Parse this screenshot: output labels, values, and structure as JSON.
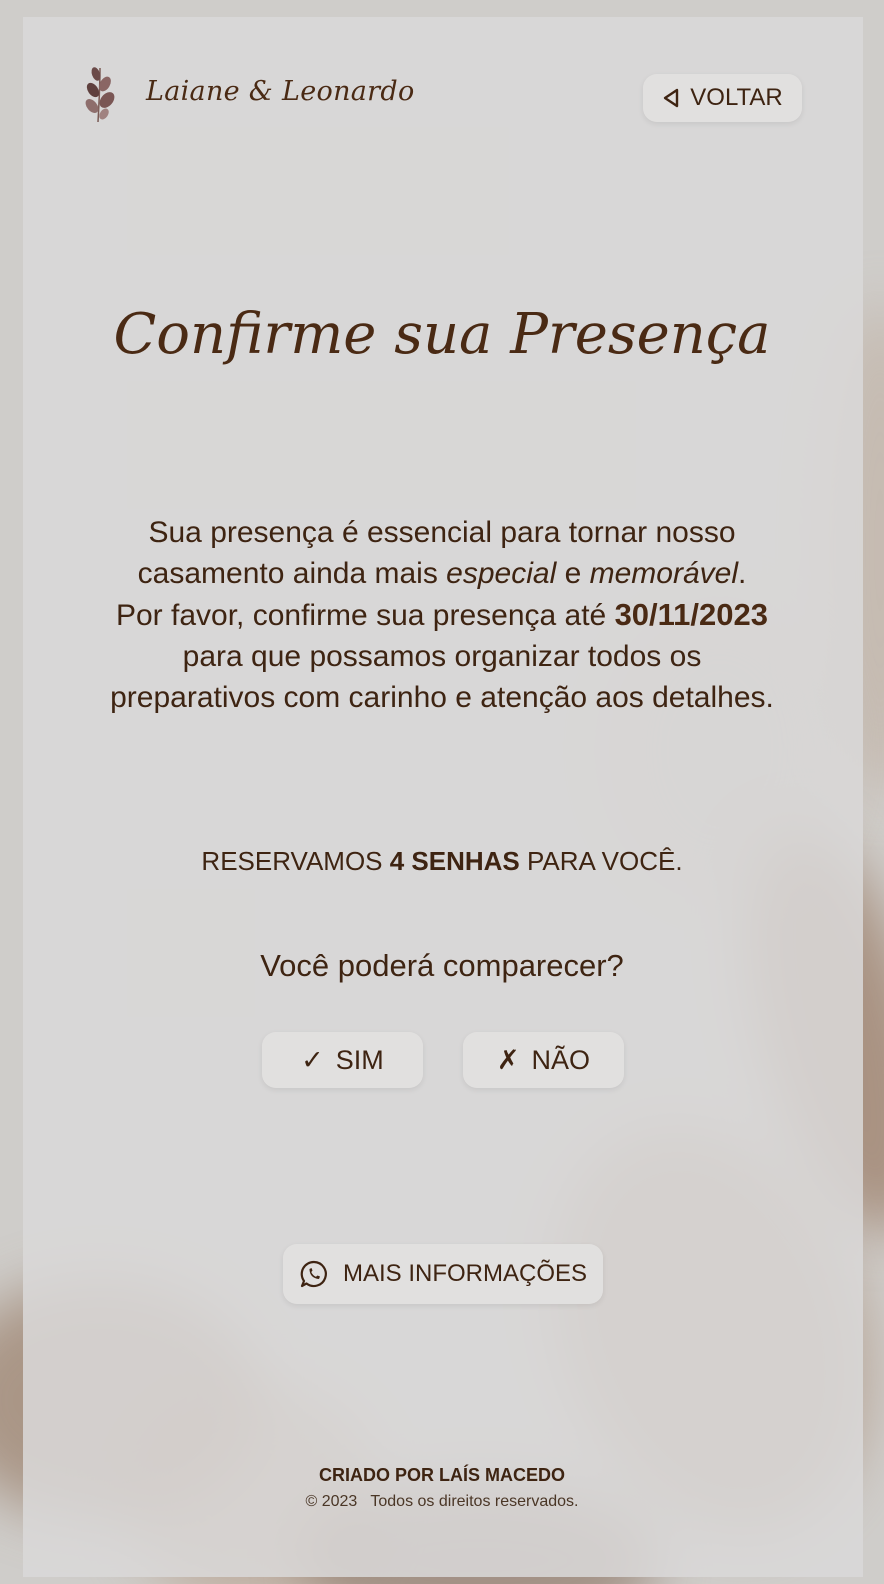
{
  "header": {
    "couple_name": "Laiane & Leonardo",
    "back_button_label": "VOLTAR",
    "logo_icon": "leaf-branch-icon",
    "back_icon": "triangle-left-icon"
  },
  "main": {
    "title": "Confirme sua Presença",
    "paragraph": {
      "line1_text": "Sua presença é essencial para tornar nosso casamento ainda mais ",
      "special": "especial",
      "and": " e ",
      "memorable": "memorável",
      "period": ".",
      "line2_prefix": "Por favor, confirme sua presença até ",
      "deadline": "30/11/2023",
      "line2_suffix": " para que possamos organizar todos os preparativos com carinho e atenção aos detalhes."
    },
    "reservation": {
      "prefix": "RESERVAMOS ",
      "count": "4 SENHAS",
      "suffix": " PARA VOCÊ."
    },
    "question": "Você poderá comparecer?",
    "yes_button": {
      "icon": "✓",
      "label": "SIM"
    },
    "no_button": {
      "icon": "✗",
      "label": "NÃO"
    },
    "info_button": {
      "label": "MAIS INFORMAÇÕES",
      "icon": "whatsapp-icon"
    }
  },
  "footer": {
    "credit": "CRIADO POR LAÍS MACEDO",
    "copyright_year": "© 2023",
    "rights": "Todos os direitos reservados."
  },
  "colors": {
    "text": "#4a2a14",
    "panel": "#dad9d8",
    "button_bg": "#e1e0df"
  }
}
